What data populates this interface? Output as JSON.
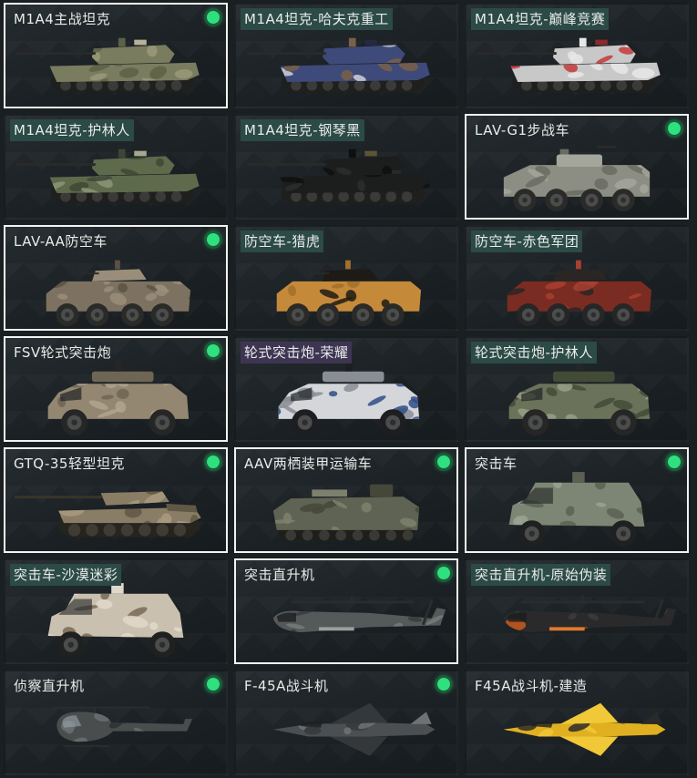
{
  "vehicles": [
    {
      "name": "M1A4主战坦克",
      "selected": true,
      "owned": true,
      "shape": "tank",
      "camo": "desert-green",
      "label_style": "none",
      "colors": [
        "#7a7c5f",
        "#9a9a7a",
        "#5c6147",
        "#b7b39b"
      ]
    },
    {
      "name": "M1A4坦克-哈夫克重工",
      "selected": false,
      "owned": false,
      "shape": "tank",
      "camo": "blue-white",
      "label_style": "teal",
      "colors": [
        "#3e4a7a",
        "#d0d0d8",
        "#7a6048",
        "#232a45"
      ]
    },
    {
      "name": "M1A4坦克-巅峰竞赛",
      "selected": false,
      "owned": false,
      "shape": "tank",
      "camo": "red-white",
      "label_style": "teal",
      "colors": [
        "#c8c8c8",
        "#c43a3a",
        "#e8e8e8",
        "#8a2a2a"
      ]
    },
    {
      "name": "M1A4坦克-护林人",
      "selected": false,
      "owned": false,
      "shape": "tank",
      "camo": "forest",
      "label_style": "teal",
      "colors": [
        "#5d6a4c",
        "#8c9478",
        "#3d4634",
        "#a6a88e"
      ]
    },
    {
      "name": "M1A4坦克-钢琴黑",
      "selected": false,
      "owned": false,
      "shape": "tank",
      "camo": "black",
      "label_style": "teal",
      "colors": [
        "#1c1d1d",
        "#2c2d2c",
        "#0e0f0f",
        "#5e5436"
      ]
    },
    {
      "name": "LAV-G1步战车",
      "selected": true,
      "owned": true,
      "shape": "wheeled8",
      "camo": "grey",
      "label_style": "none",
      "colors": [
        "#8c8d83",
        "#a4a59b",
        "#6a6b62",
        "#2a2b29"
      ]
    },
    {
      "name": "LAV-AA防空车",
      "selected": true,
      "owned": true,
      "shape": "wheeled8aa",
      "camo": "tan",
      "label_style": "none",
      "colors": [
        "#7d7261",
        "#9a8e7a",
        "#5a5244",
        "#2a2a28"
      ]
    },
    {
      "name": "防空车-猎虎",
      "selected": false,
      "owned": false,
      "shape": "wheeled8aa",
      "camo": "tiger",
      "label_style": "teal",
      "colors": [
        "#c48a3a",
        "#1e1a16",
        "#a36f2c",
        "#2a2a28"
      ]
    },
    {
      "name": "防空车-赤色军团",
      "selected": false,
      "owned": false,
      "shape": "wheeled8aa",
      "camo": "red-dark",
      "label_style": "teal",
      "colors": [
        "#7a2c22",
        "#2a2624",
        "#a84030",
        "#262626"
      ]
    },
    {
      "name": "FSV轮式突击炮",
      "selected": true,
      "owned": true,
      "shape": "armored4",
      "camo": "tan",
      "label_style": "none",
      "colors": [
        "#938772",
        "#b0a58e",
        "#6f6554",
        "#262626"
      ]
    },
    {
      "name": "轮式突击炮-荣耀",
      "selected": false,
      "owned": false,
      "shape": "armored4",
      "camo": "blue-white",
      "label_style": "purple",
      "colors": [
        "#d4d6da",
        "#2e4d86",
        "#8a8d94",
        "#1e1e22"
      ]
    },
    {
      "name": "轮式突击炮-护林人",
      "selected": false,
      "owned": false,
      "shape": "armored4",
      "camo": "forest",
      "label_style": "teal",
      "colors": [
        "#6a735a",
        "#9aa087",
        "#434b37",
        "#262626"
      ]
    },
    {
      "name": "GTQ-35轻型坦克",
      "selected": true,
      "owned": true,
      "shape": "lighttank",
      "camo": "tan",
      "label_style": "none",
      "colors": [
        "#8a7d66",
        "#a8997f",
        "#605745",
        "#3a352a"
      ]
    },
    {
      "name": "AAV两栖装甲运输车",
      "selected": true,
      "owned": true,
      "shape": "aav",
      "camo": "green",
      "label_style": "none",
      "colors": [
        "#5f6353",
        "#7c806d",
        "#454839",
        "#282924"
      ]
    },
    {
      "name": "突击车",
      "selected": true,
      "owned": true,
      "shape": "mrap",
      "camo": "green",
      "label_style": "none",
      "colors": [
        "#7d8574",
        "#9aa291",
        "#5a6152",
        "#1f2020"
      ]
    },
    {
      "name": "突击车-沙漠迷彩",
      "selected": false,
      "owned": false,
      "shape": "mrap",
      "camo": "desert",
      "label_style": "teal",
      "colors": [
        "#c9c0b0",
        "#7a6a55",
        "#e0d8ca",
        "#1f2020"
      ]
    },
    {
      "name": "突击直升机",
      "selected": true,
      "owned": true,
      "shape": "heli",
      "camo": "grey",
      "label_style": "none",
      "colors": [
        "#55595a",
        "#767a7b",
        "#393c3d",
        "#9aa0a0"
      ]
    },
    {
      "name": "突击直升机-原始伪装",
      "selected": false,
      "owned": false,
      "shape": "heli",
      "camo": "orange",
      "label_style": "teal",
      "colors": [
        "#2a2a2a",
        "#c85a1e",
        "#3c3c3c",
        "#e07a30"
      ]
    },
    {
      "name": "侦察直升机",
      "selected": false,
      "owned": true,
      "shape": "lightheli",
      "camo": "grey",
      "label_style": "none",
      "colors": [
        "#4a4d4e",
        "#6a6e6f",
        "#2e3031",
        "#8a8e8f"
      ]
    },
    {
      "name": "F-45A战斗机",
      "selected": false,
      "owned": true,
      "shape": "jet",
      "camo": "grey",
      "label_style": "none",
      "colors": [
        "#4c4f52",
        "#6e7275",
        "#35383a",
        "#9a9ea0"
      ]
    },
    {
      "name": "F45A战斗机-建造",
      "selected": false,
      "owned": false,
      "shape": "jet",
      "camo": "yellow",
      "label_style": "none",
      "colors": [
        "#e0b020",
        "#2a2a2a",
        "#f0c838",
        "#8a6a10"
      ]
    }
  ]
}
